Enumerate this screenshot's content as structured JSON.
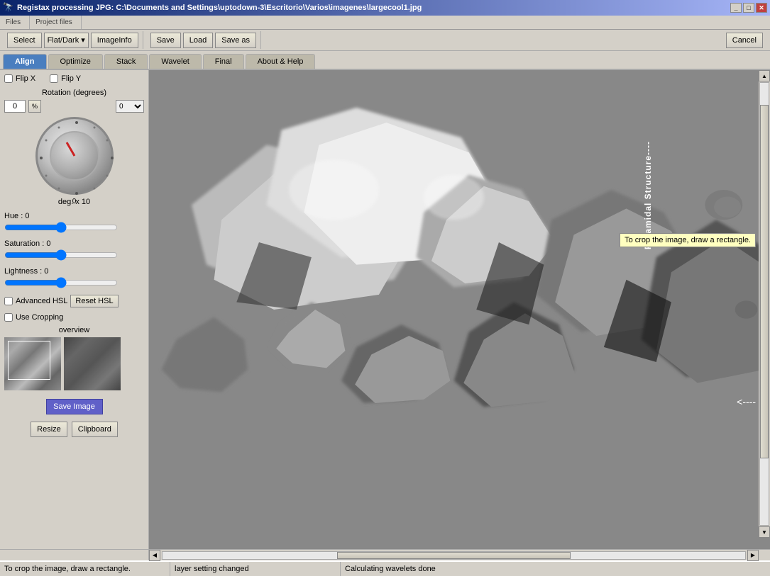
{
  "window": {
    "title": "Registax processing JPG: C:\\Documents and Settings\\uptodown-3\\Escritorio\\Varios\\imagenes\\largecool1.jpg",
    "icon": "🔭"
  },
  "toolbar": {
    "files_label": "Files",
    "project_files_label": "Project files",
    "select_label": "Select",
    "flat_dark_label": "Flat/Dark ▾",
    "image_info_label": "ImageInfo",
    "save_label": "Save",
    "load_label": "Load",
    "save_as_label": "Save as",
    "cancel_label": "Cancel"
  },
  "tabs": [
    {
      "id": "align",
      "label": "Align",
      "active": true
    },
    {
      "id": "optimize",
      "label": "Optimize",
      "active": false
    },
    {
      "id": "stack",
      "label": "Stack",
      "active": false
    },
    {
      "id": "wavelet",
      "label": "Wavelet",
      "active": false
    },
    {
      "id": "final",
      "label": "Final",
      "active": false
    },
    {
      "id": "about",
      "label": "About & Help",
      "active": false
    }
  ],
  "panel": {
    "flip_x_label": "Flip X",
    "flip_y_label": "Flip Y",
    "rotation_label": "Rotation (degrees)",
    "rotation_value": "0",
    "rotation_unit": "%",
    "deg_x10_label": "deg. x 10",
    "zero_label": "0",
    "hue_label": "Hue : 0",
    "saturation_label": "Saturation : 0",
    "lightness_label": "Lightness : 0",
    "advanced_hsl_label": "Advanced HSL",
    "reset_hsl_label": "Reset HSL",
    "use_cropping_label": "Use Cropping",
    "overview_label": "overview",
    "save_image_label": "Save Image",
    "resize_label": "Resize",
    "clipboard_label": "Clipboard"
  },
  "image": {
    "annotation": "Pyramidal Structure----",
    "tooltip": "To crop the image, draw a rectangle.",
    "side_arrow": "<----"
  },
  "statusbar": {
    "pane1": "To crop the image, draw a rectangle.",
    "pane2": "layer setting changed",
    "pane3": "Calculating wavelets done"
  }
}
